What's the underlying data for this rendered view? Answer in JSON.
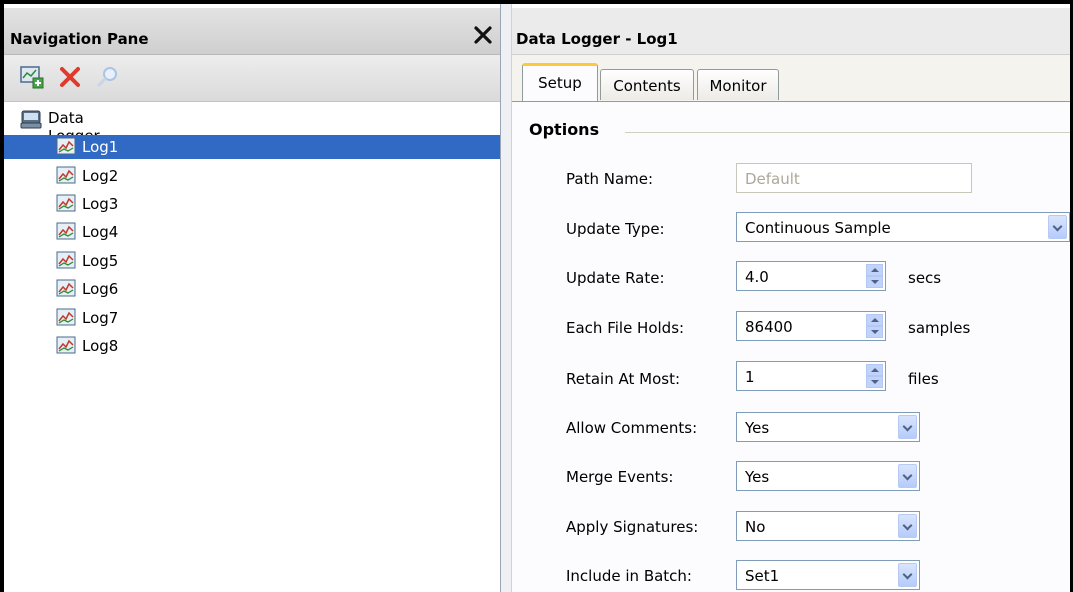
{
  "nav": {
    "title": "Navigation Pane",
    "toolbar": [
      "add-log-icon",
      "delete-icon",
      "refresh-icon"
    ],
    "root_label": "Data Logger",
    "items": [
      "Log1",
      "Log2",
      "Log3",
      "Log4",
      "Log5",
      "Log6",
      "Log7",
      "Log8"
    ],
    "selected": "Log1"
  },
  "main": {
    "title": "Data Logger - Log1",
    "tabs": [
      "Setup",
      "Contents",
      "Monitor"
    ],
    "active_tab": "Setup",
    "section": "Options"
  },
  "options": {
    "path_name": {
      "label": "Path Name:",
      "placeholder": "Default"
    },
    "update_type": {
      "label": "Update Type:",
      "value": "Continuous Sample"
    },
    "update_rate": {
      "label": "Update Rate:",
      "value": "4.0",
      "unit": "secs"
    },
    "each_file_holds": {
      "label": "Each File Holds:",
      "value": "86400",
      "unit": "samples"
    },
    "retain_at_most": {
      "label": "Retain At Most:",
      "value": "1",
      "unit": "files"
    },
    "allow_comments": {
      "label": "Allow Comments:",
      "value": "Yes"
    },
    "merge_events": {
      "label": "Merge Events:",
      "value": "Yes"
    },
    "apply_signatures": {
      "label": "Apply Signatures:",
      "value": "No"
    },
    "include_in_batch": {
      "label": "Include in Batch:",
      "value": "Set1"
    }
  },
  "colors": {
    "selection": "#316ac5",
    "tab_highlight": "#ffc83c",
    "field_border": "#7f9db9"
  }
}
